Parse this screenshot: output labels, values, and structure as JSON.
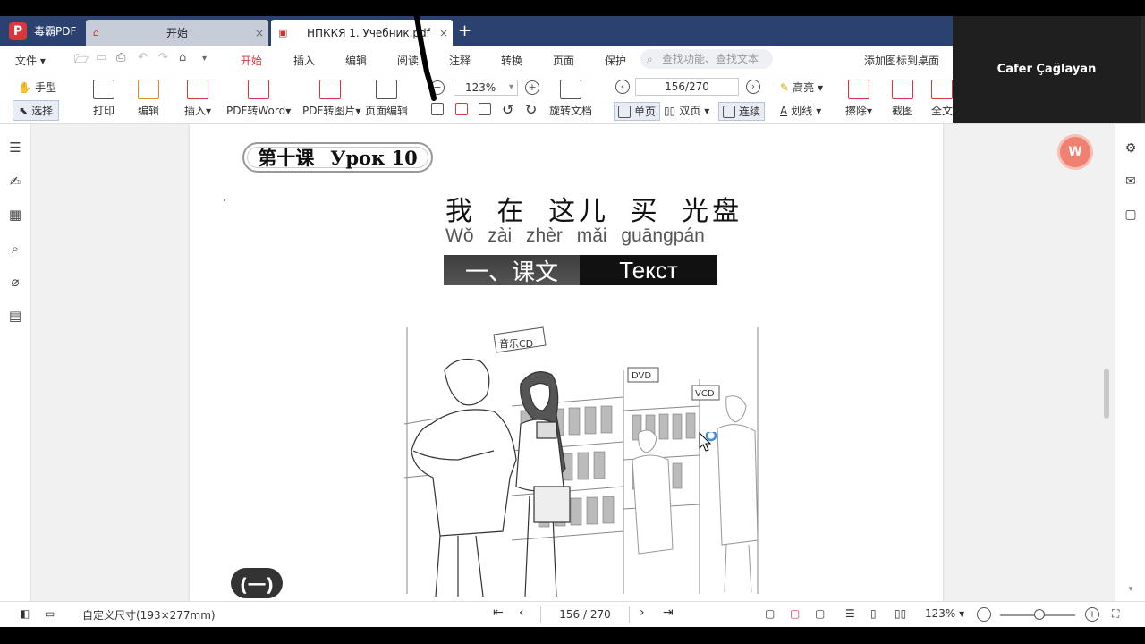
{
  "app": {
    "name": "毒霸PDF"
  },
  "tabs": [
    {
      "label": "开始",
      "close": "×"
    },
    {
      "label": "НПККЯ 1. Учебник.pdf",
      "close": "×"
    }
  ],
  "tab_add": "+",
  "menu": {
    "file": "文件",
    "items": [
      "开始",
      "插入",
      "编辑",
      "阅读",
      "注释",
      "转换",
      "页面",
      "保护"
    ],
    "search_placeholder": "查找功能、查找文本",
    "pin": "添加图标到桌面"
  },
  "ribbon": {
    "hand": "手型",
    "select": "选择",
    "print": "打印",
    "edit": "编辑",
    "insert": "插入",
    "pdf_to_word": "PDF转Word",
    "pdf_to_image": "PDF转图片",
    "page_edit": "页面编辑",
    "zoom": "123%",
    "rotate_doc": "旋转文档",
    "page_input": "156/270",
    "single": "单页",
    "double": "双页",
    "continuous": "连续",
    "highlight": "高亮",
    "underline": "划线",
    "erase": "擦除",
    "screenshot": "截图",
    "fulltext": "全文"
  },
  "video": {
    "participant": "Cafer Çağlayan"
  },
  "document": {
    "lesson_cn": "第十课",
    "lesson_ru": "Урок 10",
    "title_cn": "我 在 这儿 买  光盘",
    "pinyin": "Wǒ zài  zhèr  mǎi guāngpán",
    "section_cn": "一、课文",
    "section_ru": "Текст",
    "part": "(一)",
    "illus_labels": [
      "音乐CD",
      "DVD",
      "VCD"
    ]
  },
  "status": {
    "page_size": "自定义尺寸(193×277mm)",
    "page_nav": "156 / 270",
    "zoom": "123%"
  },
  "float_button_label": "W"
}
